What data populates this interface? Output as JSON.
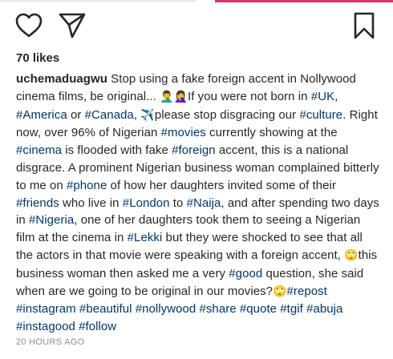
{
  "likes": "70 likes",
  "timestamp": "20 HOURS AGO",
  "colors": {
    "hashtag": "#003569",
    "text": "#262626",
    "muted": "#8e8e8e"
  },
  "icons": {
    "like": "heart-icon",
    "share": "paper-plane-icon",
    "save": "bookmark-icon"
  },
  "caption": {
    "username": "uchemaduagwu",
    "emoji": {
      "people": "🤦‍♂️🤦‍♀️",
      "plane": "✈️",
      "face": "🙄"
    },
    "segments": [
      " Stop using a fake foreign accent in Nollywood cinema films, be original... ",
      "If you were not born in ",
      "#UK",
      ", ",
      "#America",
      " or ",
      "#Canada",
      ", ",
      "please stop disgracing our ",
      "#culture",
      ". Right now, over 96% of Nigerian ",
      "#movies",
      " currently showing at the ",
      "#cinema",
      " is flooded with fake ",
      "#foreign",
      " accent, this is a national disgrace. A prominent Nigerian business woman complained bitterly to me on ",
      "#phone",
      " of how her daughters invited some of their ",
      "#friends",
      " who live in ",
      "#London",
      " to ",
      "#Naija",
      ", and after spending two days in ",
      "#Nigeria",
      ", one of her daughters took them to seeing a Nigerian film at the cinema in ",
      "#Lekki",
      " but they were shocked to see that all the actors in that movie were speaking with a foreign accent, ",
      "this business woman then asked me a very ",
      "#good",
      " question, she said when are we going to be original in our movies?",
      "#repost",
      "#instagram",
      "#beautiful",
      "#nollywood",
      "#share",
      "#quote",
      "#tgif",
      "#abuja",
      "#instagood",
      "#follow"
    ]
  }
}
